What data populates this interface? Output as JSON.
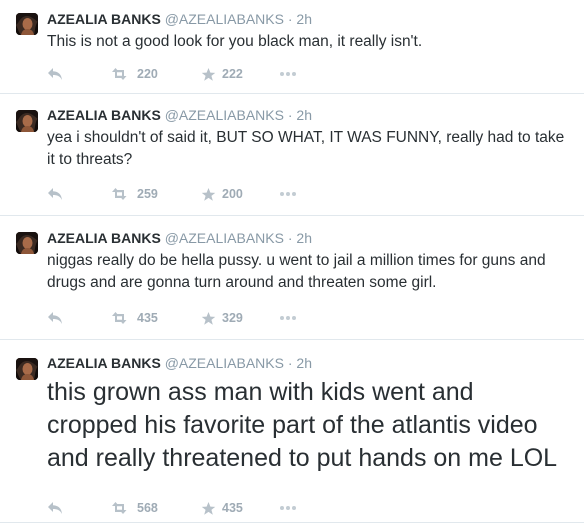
{
  "colors": {
    "text": "#292f33",
    "muted": "#8899a6",
    "action_icon": "#9fabb5",
    "divider": "#e1e8ed"
  },
  "tweets": [
    {
      "name": "AZEALIA BANKS",
      "handle": "@AZEALIABANKS",
      "separator": "·",
      "time": "2h",
      "text": "This is not a good look for you black man, it really isn't.",
      "retweets": "220",
      "favorites": "222"
    },
    {
      "name": "AZEALIA BANKS",
      "handle": "@AZEALIABANKS",
      "separator": "·",
      "time": "2h",
      "text": "yea i shouldn't of said it, BUT SO WHAT, IT WAS FUNNY, really had to take it to threats?",
      "retweets": "259",
      "favorites": "200"
    },
    {
      "name": "AZEALIA BANKS",
      "handle": "@AZEALIABANKS",
      "separator": "·",
      "time": "2h",
      "text": "niggas really do be hella pussy. u went to jail a million times for guns and drugs and are gonna turn around and threaten some girl.",
      "retweets": "435",
      "favorites": "329"
    },
    {
      "name": "AZEALIA BANKS",
      "handle": "@AZEALIABANKS",
      "separator": "·",
      "time": "2h",
      "text": "this grown ass man with kids went and cropped his favorite part of the atlantis video and really threatened to put hands on me LOL",
      "retweets": "568",
      "favorites": "435"
    }
  ]
}
